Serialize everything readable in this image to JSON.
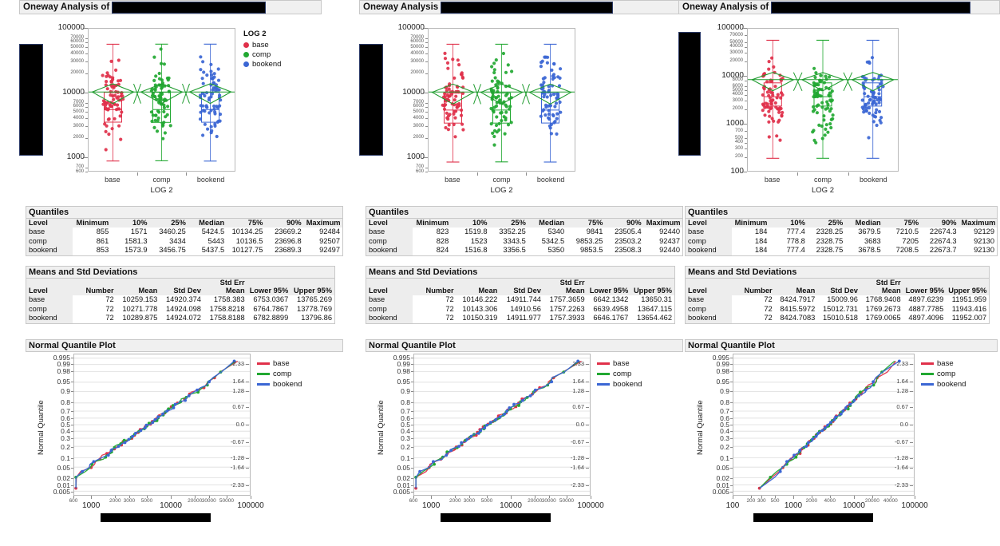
{
  "colors": {
    "base": "#e0304a",
    "comp": "#22a832",
    "bookend": "#3b66d4",
    "mean_diamond": "#1f9c2e",
    "box": "#e0304a",
    "header_bg": "#f0f0f0",
    "redaction": "#000000"
  },
  "legend": {
    "title": "LOG 2",
    "items": [
      {
        "label": "base",
        "color": "#e0304a"
      },
      {
        "label": "comp",
        "color": "#22a832"
      },
      {
        "label": "bookend",
        "color": "#3b66d4"
      }
    ]
  },
  "panels": [
    {
      "header": {
        "prefix": "Oneway Analysis of",
        "redacted": true
      },
      "oneway_plot": {
        "y_axis_major": [
          "100000",
          "10000",
          "1000"
        ],
        "y_axis_minor_upper": [
          "70000",
          "60000",
          "50000",
          "40000",
          "30000",
          "20000"
        ],
        "y_axis_minor_mid": [
          "7000",
          "6000",
          "5000",
          "4000",
          "3000",
          "2000"
        ],
        "y_axis_minor_low": [
          "700",
          "600"
        ],
        "x_categories": [
          "base",
          "comp",
          "bookend"
        ],
        "x_title": "LOG 2"
      },
      "quantiles": {
        "title": "Quantiles",
        "columns": [
          "Level",
          "Minimum",
          "10%",
          "25%",
          "Median",
          "75%",
          "90%",
          "Maximum"
        ],
        "rows": [
          [
            "base",
            "855",
            "1571",
            "3460.25",
            "5424.5",
            "10134.25",
            "23669.2",
            "92484"
          ],
          [
            "comp",
            "861",
            "1581.3",
            "3434",
            "5443",
            "10136.5",
            "23696.8",
            "92507"
          ],
          [
            "bookend",
            "853",
            "1573.9",
            "3456.75",
            "5437.5",
            "10127.75",
            "23689.3",
            "92497"
          ]
        ]
      },
      "means": {
        "title": "Means and Std Deviations",
        "columns": [
          "Level",
          "Number",
          "Mean",
          "Std Dev",
          "Std Err Mean",
          "Lower 95%",
          "Upper 95%"
        ],
        "rows": [
          [
            "base",
            "72",
            "10259.153",
            "14920.374",
            "1758.383",
            "6753.0367",
            "13765.269"
          ],
          [
            "comp",
            "72",
            "10271.778",
            "14924.098",
            "1758.8218",
            "6764.7867",
            "13778.769"
          ],
          [
            "bookend",
            "72",
            "10289.875",
            "14924.072",
            "1758.8188",
            "6782.8899",
            "13796.86"
          ]
        ]
      },
      "nqp": {
        "title": "Normal Quantile Plot",
        "y_title": "Normal Quantile",
        "y_left_ticks": [
          "0.995",
          "0.99",
          "0.98",
          "0.95",
          "0.9",
          "0.8",
          "0.7",
          "0.6",
          "0.5",
          "0.4",
          "0.3",
          "0.2",
          "0.1",
          "0.05",
          "0.02",
          "0.01",
          "0.005"
        ],
        "y_right_ticks": [
          "2.33",
          "1.64",
          "1.28",
          "0.67",
          "0.0",
          "-0.67",
          "-1.28",
          "-1.64",
          "-2.33"
        ],
        "x_ticks": [
          "600",
          "1000",
          "2000",
          "3000",
          "5000",
          "10000",
          "20000",
          "30000",
          "50000",
          "100000"
        ],
        "x_redacted": true,
        "legend": [
          "base",
          "comp",
          "bookend"
        ]
      }
    },
    {
      "header": {
        "prefix": "Oneway Analysis",
        "redacted": true
      },
      "oneway_plot": {
        "y_axis_major": [
          "100000",
          "10000",
          "1000"
        ],
        "y_axis_minor_upper": [
          "70000",
          "60000",
          "50000",
          "40000",
          "30000",
          "20000"
        ],
        "y_axis_minor_mid": [
          "7000",
          "6000",
          "5000",
          "4000",
          "3000",
          "2000"
        ],
        "y_axis_minor_low": [
          "700",
          "600"
        ],
        "x_categories": [
          "base",
          "comp",
          "bookend"
        ],
        "x_title": "LOG 2"
      },
      "quantiles": {
        "title": "Quantiles",
        "columns": [
          "Level",
          "Minimum",
          "10%",
          "25%",
          "Median",
          "75%",
          "90%",
          "Maximum"
        ],
        "rows": [
          [
            "base",
            "823",
            "1519.8",
            "3352.25",
            "5340",
            "9841",
            "23505.4",
            "92440"
          ],
          [
            "comp",
            "828",
            "1523",
            "3343.5",
            "5342.5",
            "9853.25",
            "23503.2",
            "92437"
          ],
          [
            "bookend",
            "824",
            "1516.8",
            "3356.5",
            "5350",
            "9853.5",
            "23508.3",
            "92440"
          ]
        ]
      },
      "means": {
        "title": "Means and Std Deviations",
        "columns": [
          "Level",
          "Number",
          "Mean",
          "Std Dev",
          "Std Err Mean",
          "Lower 95%",
          "Upper 95%"
        ],
        "rows": [
          [
            "base",
            "72",
            "10146.222",
            "14911.744",
            "1757.3659",
            "6642.1342",
            "13650.31"
          ],
          [
            "comp",
            "72",
            "10143.306",
            "14910.56",
            "1757.2263",
            "6639.4958",
            "13647.115"
          ],
          [
            "bookend",
            "72",
            "10150.319",
            "14911.977",
            "1757.3933",
            "6646.1767",
            "13654.462"
          ]
        ]
      },
      "nqp": {
        "title": "Normal Quantile Plot",
        "y_title": "Normal Quantile",
        "y_left_ticks": [
          "0.995",
          "0.99",
          "0.98",
          "0.95",
          "0.9",
          "0.8",
          "0.7",
          "0.6",
          "0.5",
          "0.4",
          "0.3",
          "0.2",
          "0.1",
          "0.05",
          "0.02",
          "0.01",
          "0.005"
        ],
        "y_right_ticks": [
          "2.33",
          "1.64",
          "1.28",
          "0.67",
          "0.0",
          "-0.67",
          "-1.28",
          "-1.64",
          "-2.33"
        ],
        "x_ticks": [
          "600",
          "1000",
          "2000",
          "3000",
          "5000",
          "10000",
          "20000",
          "30000",
          "50000",
          "100000"
        ],
        "x_redacted": true,
        "legend": [
          "base",
          "comp",
          "bookend"
        ]
      }
    },
    {
      "header": {
        "prefix": "Oneway Analysis of",
        "redacted": true
      },
      "oneway_plot": {
        "y_axis_major": [
          "100000",
          "10000",
          "1000",
          "100"
        ],
        "y_axis_minor_upper": [
          "70000",
          "50000",
          "40000",
          "30000",
          "20000"
        ],
        "y_axis_minor_mid": [
          "8000",
          "6000",
          "5000",
          "4000",
          "3000",
          "2000"
        ],
        "y_axis_minor_low": [
          "700",
          "500",
          "400",
          "300",
          "200"
        ],
        "x_categories": [
          "base",
          "comp",
          "bookend"
        ],
        "x_title": "LOG 2"
      },
      "quantiles": {
        "title": "Quantiles",
        "columns": [
          "Level",
          "Minimum",
          "10%",
          "25%",
          "Median",
          "75%",
          "90%",
          "Maximum"
        ],
        "rows": [
          [
            "base",
            "184",
            "777.4",
            "2328.25",
            "3679.5",
            "7210.5",
            "22674.3",
            "92129"
          ],
          [
            "comp",
            "184",
            "778.8",
            "2328.75",
            "3683",
            "7205",
            "22674.3",
            "92130"
          ],
          [
            "bookend",
            "184",
            "777.4",
            "2328.75",
            "3678.5",
            "7208.5",
            "22673.7",
            "92130"
          ]
        ]
      },
      "means": {
        "title": "Means and Std Deviations",
        "columns": [
          "Level",
          "Number",
          "Mean",
          "Std Dev",
          "Std Err Mean",
          "Lower 95%",
          "Upper 95%"
        ],
        "rows": [
          [
            "base",
            "72",
            "8424.7917",
            "15009.96",
            "1768.9408",
            "4897.6239",
            "11951.959"
          ],
          [
            "comp",
            "72",
            "8415.5972",
            "15012.731",
            "1769.2673",
            "4887.7785",
            "11943.416"
          ],
          [
            "bookend",
            "72",
            "8424.7083",
            "15010.518",
            "1769.0065",
            "4897.4096",
            "11952.007"
          ]
        ]
      },
      "nqp": {
        "title": "Normal Quantile Plot",
        "y_title": "Normal Quantile",
        "y_left_ticks": [
          "0.995",
          "0.99",
          "0.98",
          "0.95",
          "0.9",
          "0.8",
          "0.7",
          "0.6",
          "0.5",
          "0.4",
          "0.3",
          "0.2",
          "0.1",
          "0.05",
          "0.02",
          "0.01",
          "0.005"
        ],
        "y_right_ticks": [
          "2.33",
          "1.64",
          "1.28",
          "0.67",
          "0.0",
          "-0.67",
          "-1.28",
          "-1.64",
          "-2.33"
        ],
        "x_ticks": [
          "100",
          "200",
          "300",
          "500",
          "1000",
          "2000",
          "4000",
          "10000",
          "20000",
          "40000",
          "100000"
        ],
        "x_redacted": true,
        "legend": [
          "base",
          "comp",
          "bookend"
        ]
      }
    }
  ],
  "chart_data": {
    "type": "scatter",
    "title": "Oneway Analysis of (redacted) by LOG 2",
    "description": "Three JMP Oneway Analysis panels; each has a log-scale jittered dot plot with box plots and mean diamonds by group, a Quantiles table, a Means and Std Deviations table, and a Normal Quantile Plot.",
    "xlabel": "LOG 2",
    "ylabel": "(redacted)",
    "categories": [
      "base",
      "comp",
      "bookend"
    ],
    "yscale": "log",
    "ylim": [
      600,
      100000
    ],
    "ylim_panel3": [
      100,
      100000
    ],
    "series": [
      {
        "name": "base",
        "color": "#e0304a",
        "n": 72,
        "mean": 10259.153,
        "median": 5424.5,
        "q25": 3460.25,
        "q75": 10134.25,
        "min": 855,
        "max": 92484
      },
      {
        "name": "comp",
        "color": "#22a832",
        "n": 72,
        "mean": 10271.778,
        "median": 5443,
        "q25": 3434,
        "q75": 10136.5,
        "min": 861,
        "max": 92507
      },
      {
        "name": "bookend",
        "color": "#3b66d4",
        "n": 72,
        "mean": 10289.875,
        "median": 5437.5,
        "q25": 3456.75,
        "q75": 10127.75,
        "min": 853,
        "max": 92497
      }
    ],
    "normal_quantile_plot": {
      "type": "line",
      "xlabel": "(redacted)",
      "ylabel": "Normal Quantile",
      "xscale": "log",
      "xlim": [
        600,
        100000
      ],
      "probability_ticks": [
        0.005,
        0.01,
        0.02,
        0.05,
        0.1,
        0.2,
        0.3,
        0.4,
        0.5,
        0.6,
        0.7,
        0.8,
        0.9,
        0.95,
        0.98,
        0.99,
        0.995
      ],
      "z_ticks": [
        -2.33,
        -1.64,
        -1.28,
        -0.67,
        0.0,
        0.67,
        1.28,
        1.64,
        2.33
      ],
      "series": [
        "base",
        "comp",
        "bookend"
      ]
    }
  }
}
